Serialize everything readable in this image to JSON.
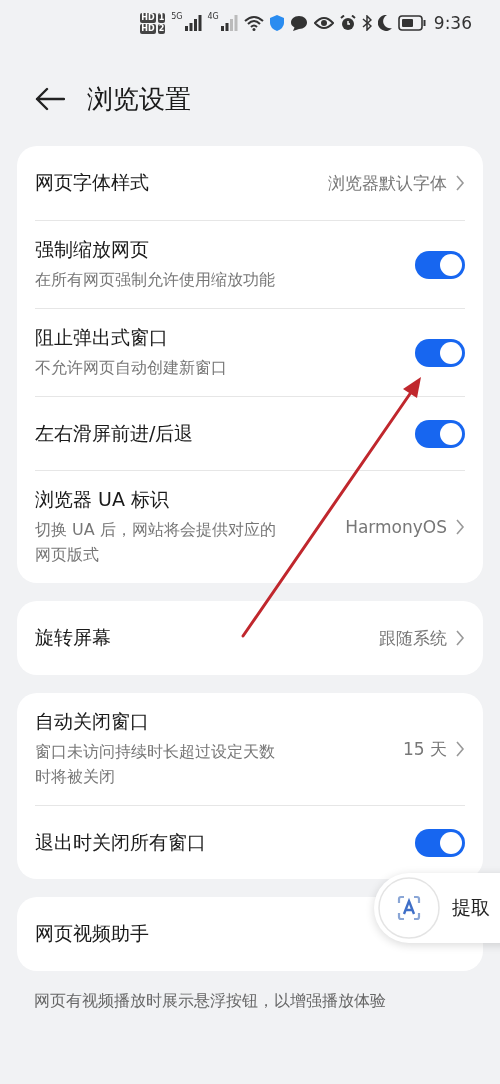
{
  "status_bar": {
    "sims": [
      {
        "badge": "HD",
        "slot": "1",
        "network": "5G"
      },
      {
        "badge": "HD",
        "slot": "2",
        "network": "4G"
      }
    ],
    "time": "9:36"
  },
  "header": {
    "title": "浏览设置"
  },
  "groups": [
    {
      "rows": [
        {
          "kind": "link",
          "title": "网页字体样式",
          "value": "浏览器默认字体"
        },
        {
          "kind": "toggle",
          "title": "强制缩放网页",
          "subtitle": "在所有网页强制允许使用缩放功能",
          "on": true
        },
        {
          "kind": "toggle",
          "title": "阻止弹出式窗口",
          "subtitle": "不允许网页自动创建新窗口",
          "on": true
        },
        {
          "kind": "toggle",
          "title": "左右滑屏前进/后退",
          "on": true
        },
        {
          "kind": "link",
          "title": "浏览器 UA 标识",
          "subtitle": "切换 UA 后，网站将会提供对应的网页版式",
          "value": "HarmonyOS"
        }
      ]
    },
    {
      "rows": [
        {
          "kind": "link",
          "title": "旋转屏幕",
          "value": "跟随系统"
        }
      ]
    },
    {
      "rows": [
        {
          "kind": "link",
          "title": "自动关闭窗口",
          "subtitle": "窗口未访问持续时长超过设定天数时将被关闭",
          "value": "15 天"
        },
        {
          "kind": "toggle",
          "title": "退出时关闭所有窗口",
          "on": true
        }
      ]
    },
    {
      "rows": [
        {
          "kind": "plain",
          "title": "网页视频助手"
        }
      ]
    }
  ],
  "footnote": "网页有视频播放时展示悬浮按钮，以增强播放体验",
  "floating_button": {
    "label": "提取"
  }
}
